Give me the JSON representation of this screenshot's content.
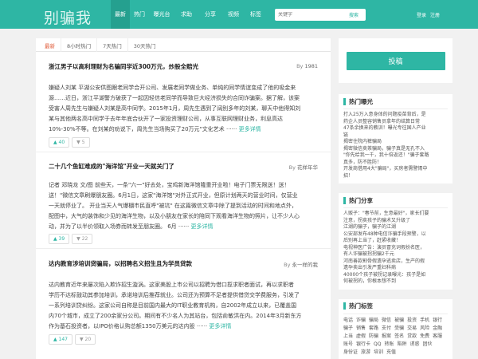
{
  "header": {
    "logo": "别骗我",
    "nav": [
      "最新",
      "热门",
      "曝光台",
      "求助",
      "分享",
      "视频",
      "标签"
    ],
    "search_placeholder": "关键字",
    "search_button": "搜索",
    "login": "登录",
    "register": "注册"
  },
  "tabs": [
    "最新",
    "8小时热门",
    "7天热门",
    "30天热门"
  ],
  "articles": [
    {
      "title": "浙江男子以高利理财为名骗同学近300万元，炒股全赔光",
      "by_prefix": "By",
      "author": "1981",
      "lines": [
        "嫌疑人刘某 平湖公安供图跟老同学合开公司、发展老同学做业务、单纯的同学情谊变成了他的吸金来",
        "源……近日，浙江平湖警方破获了一起因轻信老同学而导致巨大经济损失的合同诈骗案。据了解，该案",
        "受害人周先生与嫌疑人刘某是高中同学。2015年1月，周先生遇到了阔别多年的刘某，聊天中他得知刘",
        "某与其他两名高中同学于去年年底合伙开了一家投资理财公司，从事互联网理财业务，利息高达",
        "10%-30%不等。在刘某的劝说下，周先生当场购买了20万元\"文化艺术 ······"
      ],
      "more": "更多详情",
      "up": "40",
      "down": "5"
    },
    {
      "title": "二十几个鱼缸难成的\"海洋馆\"开业一天就关门了",
      "by_prefix": "By",
      "author": "花样年华",
      "lines": [
        "记者 邓晓龙 文/图 前些天，一条\"六一\"好去处，宝鸡新海洋馆隆重开业啦！电子门票无限送！送！",
        "送！\"微信文章刷爆朋友圈。6月1日，这家\"海洋馆\"对外正式开业，但原计划两天的营业时间，仅营业",
        "一天就停业了。 开业当天人气爆棚市民直呼\"被坑\" 在这篇微信文章中除了提到活动的时间和地点外，",
        "配图中，大气的装饰和少见的海洋生物，以及小朋友在家长的陪同下观看海洋生物的照片，让不少人心",
        "动，并为了以半价领取入场券而转发至朋友圈。 6月 ······"
      ],
      "more": "更多详情",
      "up": "39",
      "down": "22"
    },
    {
      "title": "达内教育涉培训贷骗局，以招聘名义招生且为学员贷款",
      "by_prefix": "By",
      "author": "永一样的我",
      "lines": [
        "达内教育近年来屡次陷入欺诈招生漩涡。这家美股上市公司以招聘为借口揽求职者面试，再以求职者",
        "学历不达标鼓动其参加培训，承诺培训后推荐就业。公司还为预算不足者提供借贷交学费服务，引发了",
        "一系列培训贷纠纷。这家公司自称是目前国内最大的IT职业教育机构，自2002年成立以来，已覆盖国",
        "内70个城市，成立了200余家分公司。期间有不少名人为其站台，包括俞敏洪在内。2014年3月新东方",
        "作为基石投资者，以IPO价格认购总额1350万美元的达内股 ······"
      ],
      "more": "更多详情",
      "up": "147",
      "down": "20"
    }
  ],
  "sidebar": {
    "post_button": "投稿",
    "hot_exposure": {
      "title": "热门曝光",
      "items": [
        "打入25万入意身体的问题疫苗背后，是",
        "药企人员整容销售员拿年的结算日常",
        "47条余换来的教训！曝光专往国人产业",
        "链",
        "揭密住院内裤骗局",
        "揭密微信卖茶骗局，骗子真是无孔不入",
        "\"你先给我一千，我十倍返还！\"骗子套路",
        "真多，防不胜防！",
        "开发商借用4大\"骗局\"，买房者需警惕中",
        "招！"
      ]
    },
    "hot_share": {
      "title": "热门分享",
      "items": [
        "人贩子：\"春节前，生意最好\"，家长们要",
        "注意，拐卖孩子的骗术又升级了",
        "江湖的骗子，骗子的江湖",
        "公安部发布48种电信诈骗手段预警，以",
        "后别再上当了，赶紧收藏！",
        "电视神医广告：演员冒充词假扮名医，",
        "有人诈骗被拐拐骗2千元",
        "河南善款割骨假遗孕逃卖店，生产的假",
        "遗孕卖出引发严重妇科病",
        "40000个孩子被拐记录曝光：孩子是如",
        "何被拐的，你根本想不到"
      ]
    },
    "hot_tags": {
      "title": "热门标签",
      "items": [
        "电话",
        "诈骗",
        "骗局",
        "微信",
        "被骗",
        "投资",
        "手机",
        "银行",
        "骗子",
        "销售",
        "套路",
        "支付",
        "受骗",
        "交易",
        "风险",
        "金融",
        "上当",
        "虚假",
        "防骗",
        "报案",
        "签名",
        "贷款",
        "免费",
        "客服",
        "账号",
        "银行卡",
        "QQ",
        "转账",
        "陷阱",
        "诱惑",
        "团伙",
        "身份证",
        "旅游",
        "培训",
        "充值"
      ]
    }
  }
}
